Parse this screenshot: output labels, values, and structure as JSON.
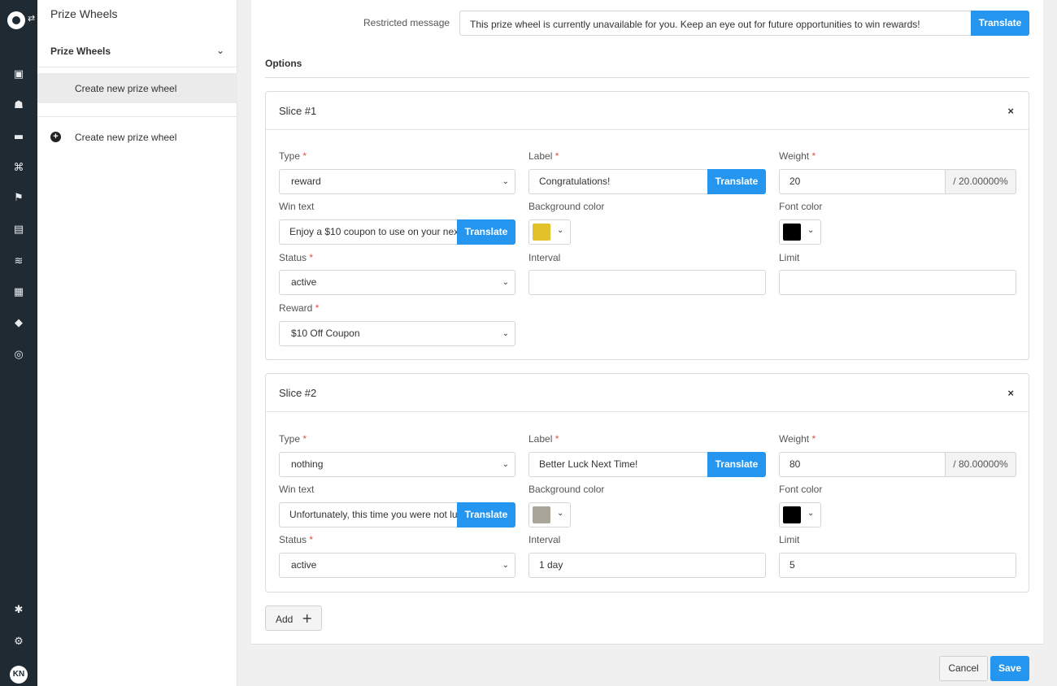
{
  "sidebar": {
    "title": "Prize Wheels",
    "group_label": "Prize Wheels",
    "active_item": "Create new prize wheel",
    "create_link": "Create new prize wheel"
  },
  "rail": {
    "icons": [
      "analytics-icon",
      "users-icon",
      "wallet-icon",
      "gift-icon",
      "flag-icon",
      "message-icon",
      "waves-icon",
      "calendar-icon",
      "tag-icon",
      "chat-icon",
      "puzzle-icon",
      "gear-icon"
    ],
    "avatar_initials": "KN"
  },
  "restricted": {
    "label": "Restricted message",
    "value": "This prize wheel is currently unavailable for you. Keep an eye out for future opportunities to win rewards!",
    "translate": "Translate"
  },
  "options_title": "Options",
  "labels": {
    "type": "Type",
    "label": "Label",
    "weight": "Weight",
    "win_text": "Win text",
    "background_color": "Background color",
    "font_color": "Font color",
    "status": "Status",
    "interval": "Interval",
    "limit": "Limit",
    "reward": "Reward",
    "required": "*",
    "translate": "Translate"
  },
  "slices": [
    {
      "title": "Slice #1",
      "close": "×",
      "type": "reward",
      "label": "Congratulations!",
      "weight": "20",
      "weight_percent": "/ 20.00000%",
      "win_text": "Enjoy a $10 coupon to use on your nex",
      "background_color": "#e3c12a",
      "font_color": "#000000",
      "status": "active",
      "interval": "",
      "limit": "",
      "reward": "$10 Off Coupon"
    },
    {
      "title": "Slice #2",
      "close": "×",
      "type": "nothing",
      "label": "Better Luck Next Time!",
      "weight": "80",
      "weight_percent": "/ 80.00000%",
      "win_text": "Unfortunately, this time you were not lu",
      "background_color": "#a9a59a",
      "font_color": "#000000",
      "status": "active",
      "interval": "1 day",
      "limit": "5"
    }
  ],
  "add_label": "Add",
  "footer": {
    "cancel": "Cancel",
    "save": "Save"
  },
  "colors": {
    "accent": "#2496f0",
    "rail": "#1f2a33",
    "required": "#e0533d"
  }
}
